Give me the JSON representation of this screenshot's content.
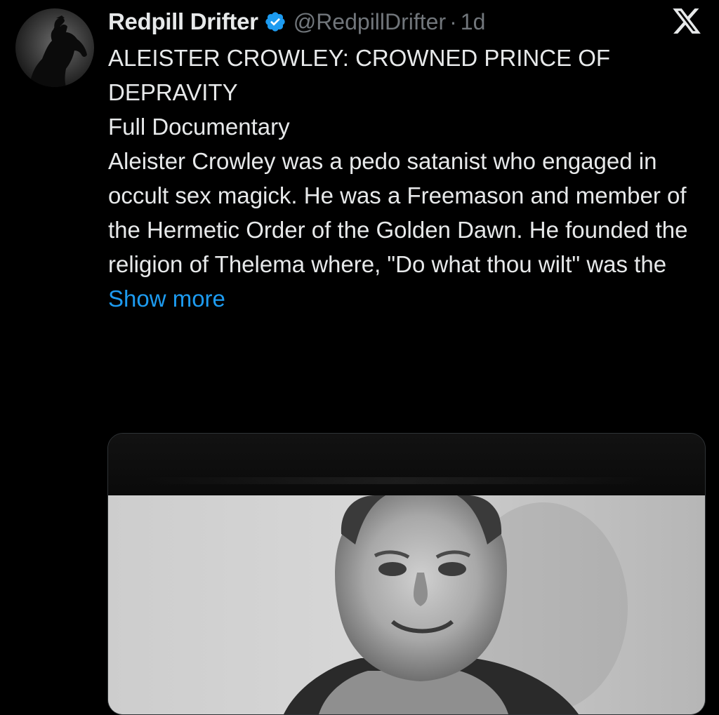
{
  "tweet": {
    "author": {
      "display_name": "Redpill Drifter",
      "handle": "@RedpillDrifter",
      "separator": "·",
      "time_ago": "1d",
      "verified": true,
      "verified_color": "#1d9bf0",
      "avatar_icon": "horse-rider-avatar"
    },
    "headline": "ALEISTER CROWLEY: CROWNED PRINCE OF DEPRAVITY",
    "subheading": "Full Documentary",
    "body": "Aleister Crowley was a pedo satanist who engaged in occult sex magick. He was a Freemason and member of the Hermetic Order of the Golden Dawn. He founded the religion of Thelema where, \"Do what thou wilt\" was the",
    "show_more_label": "Show more",
    "link_color": "#1d9bf0",
    "media": {
      "type": "video",
      "thumbnail_icon": "black-and-white-portrait-thumbnail"
    }
  },
  "app": {
    "logo_icon": "x-logo-icon"
  }
}
